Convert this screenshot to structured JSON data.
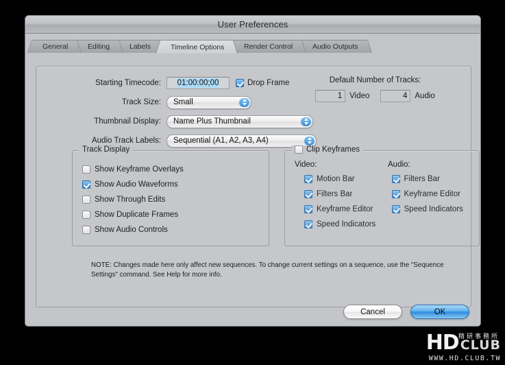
{
  "window": {
    "title": "User Preferences"
  },
  "tabs": [
    {
      "label": "General",
      "active": false
    },
    {
      "label": "Editing",
      "active": false
    },
    {
      "label": "Labels",
      "active": false
    },
    {
      "label": "Timeline Options",
      "active": true
    },
    {
      "label": "Render Control",
      "active": false
    },
    {
      "label": "Audio Outputs",
      "active": false
    }
  ],
  "form": {
    "starting_timecode": {
      "label": "Starting Timecode:",
      "value": "01:00:00;00"
    },
    "drop_frame": {
      "label": "Drop Frame",
      "checked": true
    },
    "track_size": {
      "label": "Track Size:",
      "value": "Small"
    },
    "thumbnail_display": {
      "label": "Thumbnail Display:",
      "value": "Name Plus Thumbnail"
    },
    "audio_track_labels": {
      "label": "Audio Track Labels:",
      "value": "Sequential (A1, A2, A3, A4)"
    }
  },
  "default_tracks": {
    "title": "Default Number of Tracks:",
    "video": {
      "value": "1",
      "label": "Video"
    },
    "audio": {
      "value": "4",
      "label": "Audio"
    }
  },
  "track_display": {
    "legend": "Track Display",
    "items": [
      {
        "label": "Show Keyframe Overlays",
        "checked": false
      },
      {
        "label": "Show Audio Waveforms",
        "checked": true
      },
      {
        "label": "Show Through Edits",
        "checked": false
      },
      {
        "label": "Show Duplicate Frames",
        "checked": false
      },
      {
        "label": "Show Audio Controls",
        "checked": false
      }
    ]
  },
  "clip_keyframes": {
    "legend": "Clip Keyframes",
    "enabled": false,
    "video_header": "Video:",
    "audio_header": "Audio:",
    "video_items": [
      {
        "label": "Motion Bar",
        "checked": true
      },
      {
        "label": "Filters Bar",
        "checked": true
      },
      {
        "label": "Keyframe Editor",
        "checked": true
      },
      {
        "label": "Speed Indicators",
        "checked": true
      }
    ],
    "audio_items": [
      {
        "label": "Filters Bar",
        "checked": true
      },
      {
        "label": "Keyframe Editor",
        "checked": true
      },
      {
        "label": "Speed Indicators",
        "checked": true
      }
    ]
  },
  "note": "NOTE: Changes made here only affect new sequences. To change current settings on a sequence, use the \"Sequence Settings\" command. See Help for more info.",
  "buttons": {
    "cancel": "Cancel",
    "ok": "OK"
  },
  "watermark": {
    "hd": "HD",
    "club": "CLUB",
    "chinese": "精研事務所",
    "url": "WWW.HD.CLUB.TW"
  },
  "colors": {
    "window_bg": "#c3c5c8",
    "accent_blue": "#2f86d4",
    "selection_blue": "#addaf5"
  }
}
